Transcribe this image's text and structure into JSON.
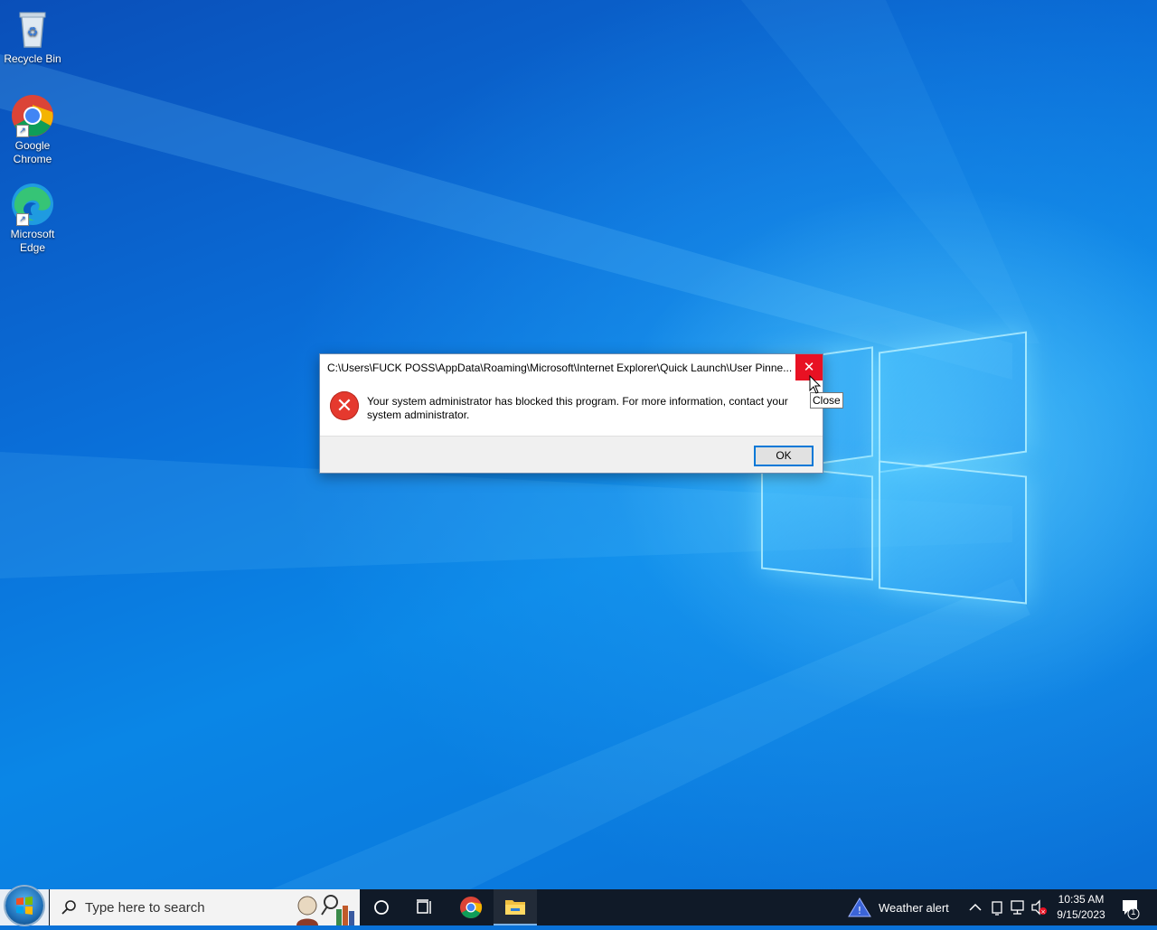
{
  "desktop": {
    "icons": [
      {
        "label_1": "Recycle Bin",
        "label_2": ""
      },
      {
        "label_1": "Google",
        "label_2": "Chrome"
      },
      {
        "label_1": "Microsoft",
        "label_2": "Edge"
      }
    ]
  },
  "dialog": {
    "title": "C:\\Users\\FUCK POSS\\AppData\\Roaming\\Microsoft\\Internet Explorer\\Quick Launch\\User Pinne...",
    "close_glyph": "✕",
    "message": "Your system administrator has blocked this program. For more information, contact your system administrator.",
    "ok_label": "OK",
    "error_glyph": "✕"
  },
  "tooltip": {
    "text": "Close"
  },
  "taskbar": {
    "search_placeholder": "Type here to search",
    "weather_label": "Weather alert",
    "time": "10:35 AM",
    "date": "9/15/2023",
    "notification_count": "1"
  },
  "colors": {
    "close_red": "#e81123",
    "accent_blue": "#0078d7",
    "taskbar": "#101a28"
  }
}
